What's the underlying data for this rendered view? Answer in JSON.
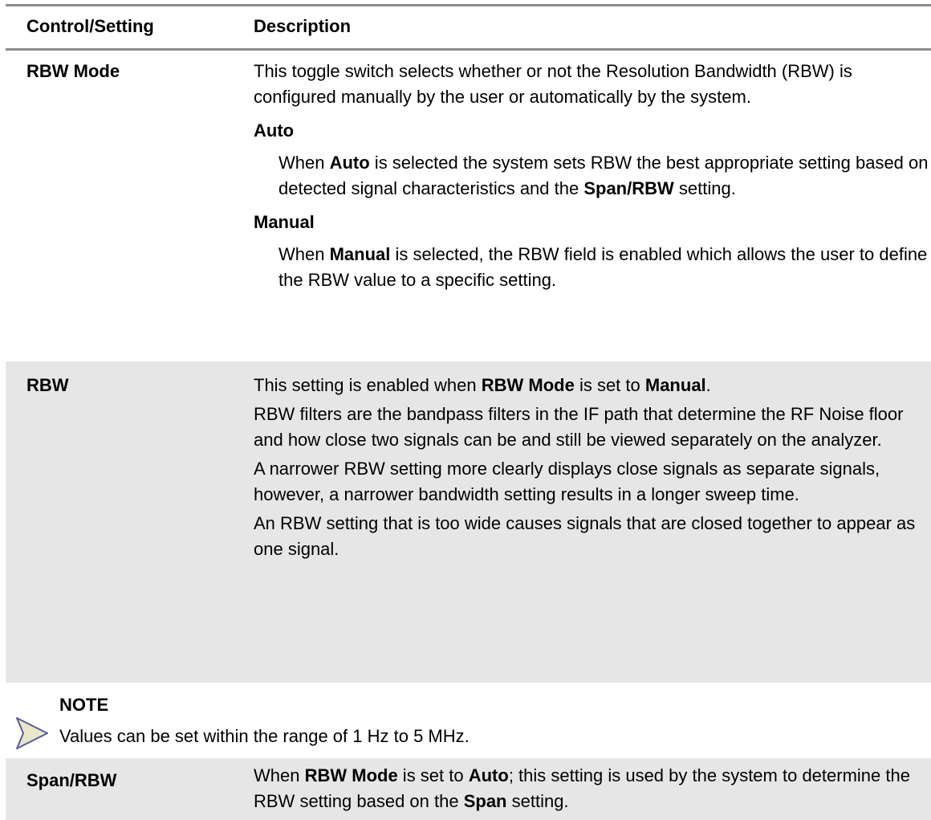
{
  "table": {
    "header": {
      "control": "Control/Setting",
      "description": "Description"
    },
    "rbw_mode": {
      "control": "RBW Mode",
      "intro": "This toggle switch selects whether or not the Resolution Bandwidth (RBW) is configured manually by the user or automatically by the system.",
      "auto": {
        "title": "Auto",
        "t1": "When ",
        "b1": "Auto",
        "t2": " is selected the system sets RBW the best appropriate setting based on detected signal characteristics and the ",
        "b2": "Span/RBW",
        "t3": " setting."
      },
      "manual": {
        "title": "Manual",
        "t1": "When ",
        "b1": "Manual",
        "t2": " is selected, the RBW field is enabled which allows the user to define the RBW value to a specific setting."
      }
    },
    "rbw": {
      "control": "RBW",
      "p1_t1": "This setting is enabled when ",
      "p1_b1": "RBW Mode",
      "p1_t2": " is set to ",
      "p1_b2": "Manual",
      "p1_t3": ".",
      "p2": "RBW filters are the bandpass filters in the IF path that determine the RF Noise floor and how close two signals can be and still be viewed separately on the analyzer.",
      "p3": "A narrower RBW setting more clearly displays close signals as separate signals, however, a narrower bandwidth setting results in a longer sweep time.",
      "p4": "An RBW setting that is too wide causes signals that are closed together to appear as one signal."
    },
    "note": {
      "icon": "note-arrow-icon",
      "title": "NOTE",
      "text": "Values can be set within the range of 1 Hz to 5 MHz."
    },
    "span_rbw": {
      "control": "Span/RBW",
      "t1": "When ",
      "b1": "RBW Mode",
      "t2": " is set to ",
      "b2": "Auto",
      "t3": "; this setting is used by the system to determine the RBW setting based on the ",
      "b3": "Span",
      "t4": " setting."
    }
  },
  "colors": {
    "rule": "#8c8c8c",
    "shade": "#e6e6e6",
    "icon_stroke": "#5a5aa0",
    "icon_fill": "#e8e8c8"
  }
}
